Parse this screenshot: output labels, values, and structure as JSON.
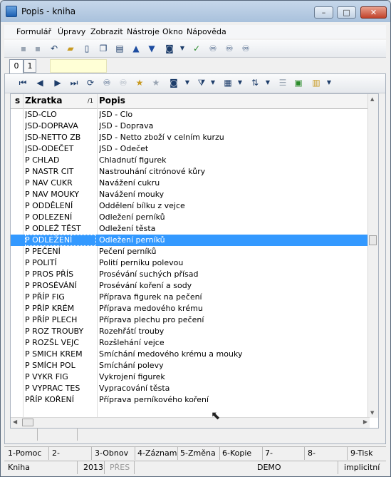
{
  "window": {
    "title": "Popis - kniha"
  },
  "menu": [
    "Formulář",
    "Úpravy",
    "Zobrazit",
    "Nástroje",
    "Okno",
    "Nápověda"
  ],
  "tabs": [
    "0",
    "1"
  ],
  "grid": {
    "headers": {
      "s": "s",
      "zkratka": "Zkratka",
      "sort": "/1",
      "popis": "Popis"
    },
    "rows": [
      {
        "zkratka": "JSD-CLO",
        "popis": "JSD - Clo"
      },
      {
        "zkratka": "JSD-DOPRAVA",
        "popis": "JSD - Doprava"
      },
      {
        "zkratka": "JSD-NETTO ZB",
        "popis": "JSD - Netto zboží v celním kurzu"
      },
      {
        "zkratka": "JSD-ODEČET",
        "popis": "JSD - Odečet"
      },
      {
        "zkratka": "P CHLAD",
        "popis": "Chladnutí figurek"
      },
      {
        "zkratka": "P NASTR CIT",
        "popis": "Nastrouhání citrónové kůry"
      },
      {
        "zkratka": "P NAV CUKR",
        "popis": "Navážení cukru"
      },
      {
        "zkratka": "P NAV MOUKY",
        "popis": "Navážení mouky"
      },
      {
        "zkratka": "P ODDĚLENÍ",
        "popis": "Oddělení bílku z vejce"
      },
      {
        "zkratka": "P ODLEZENÍ",
        "popis": "Odležení perníků"
      },
      {
        "zkratka": "P ODLEŽ TĚST",
        "popis": "Odležení těsta"
      },
      {
        "zkratka": "P ODLEŽENÍ",
        "popis": "Odležení perníků",
        "selected": true
      },
      {
        "zkratka": "P PEČENÍ",
        "popis": "Pečení perníků"
      },
      {
        "zkratka": "P POLITÍ",
        "popis": "Polití perníku polevou"
      },
      {
        "zkratka": "P PROS PŘÍS",
        "popis": "Prosévání suchých přísad"
      },
      {
        "zkratka": "P PROSÉVÁNÍ",
        "popis": "Prosévání koření a sody"
      },
      {
        "zkratka": "P PŘÍP FIG",
        "popis": "Příprava figurek na pečení"
      },
      {
        "zkratka": "P PŘÍP KRÉM",
        "popis": "Příprava medového krému"
      },
      {
        "zkratka": "P PŘÍP PLECH",
        "popis": "Příprava plechu pro pečení"
      },
      {
        "zkratka": "P ROZ TROUBY",
        "popis": "Rozehřátí trouby"
      },
      {
        "zkratka": "P ROZŠL VEJC",
        "popis": "Rozšlehání vejce"
      },
      {
        "zkratka": "P SMICH KREM",
        "popis": "Smíchání medového krému a mouky"
      },
      {
        "zkratka": "P SMÍCH POL",
        "popis": "Smíchání polevy"
      },
      {
        "zkratka": "P VYKR FIG",
        "popis": "Vykrojení figurek"
      },
      {
        "zkratka": "P VYPRAC TES",
        "popis": "Vypracování těsta"
      },
      {
        "zkratka": "PŘÍP KOŘENÍ",
        "popis": "Příprava perníkového koření"
      }
    ]
  },
  "fkeys": [
    "1-Pomoc",
    "2-",
    "3-Obnov",
    "4-Záznam",
    "5-Změna",
    "6-Kopie",
    "7-",
    "8-",
    "9-Tisk"
  ],
  "status": {
    "module": "Kniha",
    "year": "2013",
    "pres": "PŘES",
    "company": "DEMO",
    "mode": "implicitní"
  }
}
